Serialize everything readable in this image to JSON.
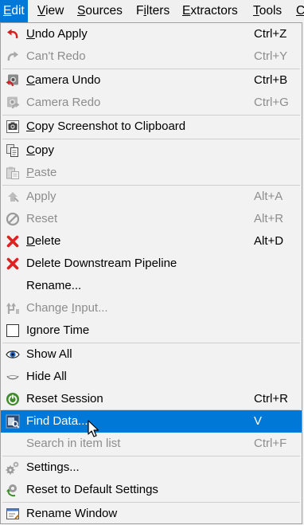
{
  "menubar": {
    "items": [
      {
        "pre": "",
        "mn": "E",
        "post": "dit"
      },
      {
        "pre": "",
        "mn": "V",
        "post": "iew"
      },
      {
        "pre": "",
        "mn": "S",
        "post": "ources"
      },
      {
        "pre": "F",
        "mn": "i",
        "post": "lters"
      },
      {
        "pre": "",
        "mn": "E",
        "post": "xtractors"
      },
      {
        "pre": "",
        "mn": "T",
        "post": "ools"
      },
      {
        "pre": "",
        "mn": "C",
        "post": ""
      }
    ]
  },
  "menu": {
    "undo_apply": {
      "pre": "",
      "mn": "U",
      "post": "ndo Apply",
      "shortcut": "Ctrl+Z"
    },
    "cant_redo": {
      "pre": "Can't Redo",
      "mn": "",
      "post": "",
      "shortcut": "Ctrl+Y"
    },
    "camera_undo": {
      "pre": "",
      "mn": "C",
      "post": "amera Undo",
      "shortcut": "Ctrl+B"
    },
    "camera_redo": {
      "pre": "Camera Redo",
      "mn": "",
      "post": "",
      "shortcut": "Ctrl+G"
    },
    "copy_screenshot": {
      "pre": "",
      "mn": "C",
      "post": "opy Screenshot to Clipboard",
      "shortcut": ""
    },
    "copy": {
      "pre": "",
      "mn": "C",
      "post": "opy",
      "shortcut": ""
    },
    "paste": {
      "pre": "",
      "mn": "P",
      "post": "aste",
      "shortcut": ""
    },
    "apply": {
      "pre": "Apply",
      "mn": "",
      "post": "",
      "shortcut": "Alt+A"
    },
    "reset": {
      "pre": "Reset",
      "mn": "",
      "post": "",
      "shortcut": "Alt+R"
    },
    "delete": {
      "pre": "",
      "mn": "D",
      "post": "elete",
      "shortcut": "Alt+D"
    },
    "delete_downstream": {
      "pre": "Delete Downstream Pipeline",
      "mn": "",
      "post": "",
      "shortcut": ""
    },
    "rename": {
      "pre": "Rename...",
      "mn": "",
      "post": "",
      "shortcut": ""
    },
    "change_input": {
      "pre": "Change ",
      "mn": "I",
      "post": "nput...",
      "shortcut": ""
    },
    "ignore_time": {
      "pre": "I",
      "mn": "g",
      "post": "nore Time",
      "shortcut": ""
    },
    "show_all": {
      "pre": "Show All",
      "mn": "",
      "post": "",
      "shortcut": ""
    },
    "hide_all": {
      "pre": "Hide All",
      "mn": "",
      "post": "",
      "shortcut": ""
    },
    "reset_session": {
      "pre": "Reset Session",
      "mn": "",
      "post": "",
      "shortcut": "Ctrl+R"
    },
    "find_data": {
      "pre": "Find Data...",
      "mn": "",
      "post": "",
      "shortcut": "V"
    },
    "search_item_list": {
      "pre": "Search in item list",
      "mn": "",
      "post": "",
      "shortcut": "Ctrl+F"
    },
    "settings": {
      "pre": "Settings...",
      "mn": "",
      "post": "",
      "shortcut": ""
    },
    "reset_default": {
      "pre": "Reset to Default Settings",
      "mn": "",
      "post": "",
      "shortcut": ""
    },
    "rename_window": {
      "pre": "Rename Window",
      "mn": "",
      "post": "",
      "shortcut": ""
    }
  },
  "colors": {
    "highlight": "#0078d7",
    "disabled_text": "#8d8d8d",
    "delete_red": "#e02020"
  }
}
